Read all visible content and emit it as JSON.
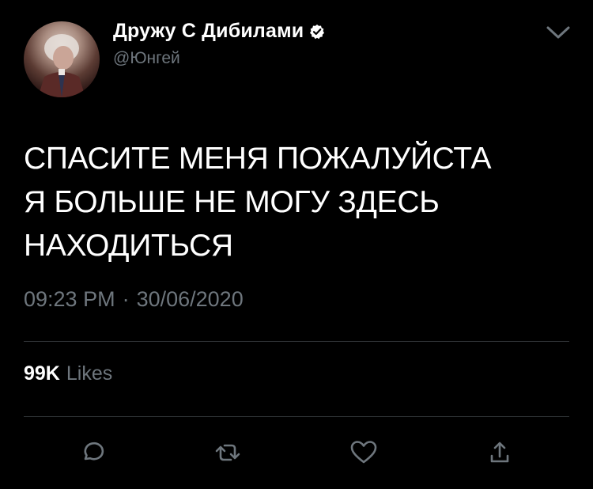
{
  "author": {
    "display_name": "Дружу С Дибилами",
    "handle": "@Юнгей",
    "verified": true
  },
  "tweet": {
    "lines": [
      "СПАСИТЕ МЕНЯ ПОЖАЛУЙСТА",
      "Я БОЛЬШЕ НЕ МОГУ ЗДЕСЬ",
      "НАХОДИТЬСЯ"
    ],
    "time": "09:23 PM",
    "separator": "·",
    "date": "30/06/2020"
  },
  "stats": {
    "likes_count": "99K",
    "likes_label": "Likes"
  },
  "icons": {
    "verified": "verified-badge-icon",
    "more": "chevron-down-icon",
    "reply": "reply-icon",
    "retweet": "retweet-icon",
    "like": "heart-icon",
    "share": "share-icon"
  },
  "colors": {
    "background": "#000000",
    "text": "#ffffff",
    "muted": "#6e767d",
    "divider": "#2f3336"
  }
}
